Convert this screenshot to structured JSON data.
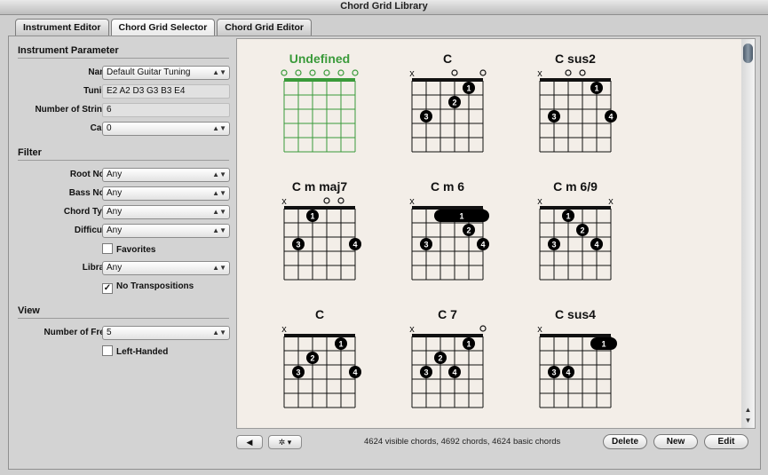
{
  "window": {
    "title": "Chord Grid Library"
  },
  "tabs": [
    {
      "label": "Instrument Editor"
    },
    {
      "label": "Chord Grid Selector"
    },
    {
      "label": "Chord Grid Editor"
    }
  ],
  "instrument": {
    "heading": "Instrument Parameter",
    "name_label": "Name:",
    "name_value": "Default Guitar Tuning",
    "tuning_label": "Tuning:",
    "tuning_value": "E2 A2 D3 G3 B3 E4",
    "strings_label": "Number of Strings:",
    "strings_value": "6",
    "capo_label": "Capo:",
    "capo_value": "0"
  },
  "filter": {
    "heading": "Filter",
    "root_label": "Root Note:",
    "root_value": "Any",
    "bass_label": "Bass Note:",
    "bass_value": "Any",
    "type_label": "Chord Type:",
    "type_value": "Any",
    "difficulty_label": "Difficulty:",
    "difficulty_value": "Any",
    "favorites_label": "Favorites",
    "library_label": "Library:",
    "library_value": "Any",
    "no_transpositions_label": "No Transpositions"
  },
  "view": {
    "heading": "View",
    "frets_label": "Number of Frets:",
    "frets_value": "5",
    "left_handed_label": "Left-Handed"
  },
  "chords": [
    {
      "name": "Undefined",
      "color": "#3a9a3a",
      "top": [
        "o",
        "o",
        "o",
        "o",
        "o",
        "o"
      ],
      "fingers": [],
      "barres": []
    },
    {
      "name": "C",
      "color": "#111111",
      "top": [
        "x",
        "",
        "",
        "o",
        "",
        "o"
      ],
      "fingers": [
        [
          5,
          1,
          "1"
        ],
        [
          4,
          2,
          "2"
        ],
        [
          2,
          3,
          "3"
        ]
      ],
      "barres": []
    },
    {
      "name": "C sus2",
      "color": "#111111",
      "top": [
        "x",
        "",
        "o",
        "o",
        "",
        ""
      ],
      "fingers": [
        [
          5,
          1,
          "1"
        ],
        [
          2,
          3,
          "3"
        ],
        [
          6,
          3,
          "4"
        ]
      ],
      "barres": []
    },
    {
      "name": "C m maj7",
      "color": "#111111",
      "top": [
        "x",
        "",
        "",
        "o",
        "o",
        ""
      ],
      "fingers": [
        [
          3,
          1,
          "1"
        ],
        [
          2,
          3,
          "3"
        ],
        [
          6,
          3,
          "4"
        ]
      ],
      "barres": []
    },
    {
      "name": "C m 6",
      "color": "#111111",
      "top": [
        "x",
        "",
        "",
        "",
        "",
        ""
      ],
      "fingers": [
        [
          5,
          2,
          "2"
        ],
        [
          2,
          3,
          "3"
        ],
        [
          6,
          3,
          "4"
        ]
      ],
      "barres": [
        [
          3,
          6,
          1,
          "1"
        ]
      ]
    },
    {
      "name": "C m 6/9",
      "color": "#111111",
      "top": [
        "x",
        "",
        "",
        "",
        "",
        "x"
      ],
      "fingers": [
        [
          3,
          1,
          "1"
        ],
        [
          4,
          2,
          "2"
        ],
        [
          2,
          3,
          "3"
        ],
        [
          5,
          3,
          "4"
        ]
      ],
      "barres": []
    },
    {
      "name": "C",
      "color": "#111111",
      "top": [
        "x",
        "",
        "",
        "",
        "",
        ""
      ],
      "fingers": [
        [
          5,
          1,
          "1"
        ],
        [
          3,
          2,
          "2"
        ],
        [
          2,
          3,
          "3"
        ],
        [
          6,
          3,
          "4"
        ]
      ],
      "barres": []
    },
    {
      "name": "C 7",
      "color": "#111111",
      "top": [
        "x",
        "",
        "",
        "",
        "",
        "o"
      ],
      "fingers": [
        [
          5,
          1,
          "1"
        ],
        [
          3,
          2,
          "2"
        ],
        [
          2,
          3,
          "3"
        ],
        [
          4,
          3,
          "4"
        ]
      ],
      "barres": []
    },
    {
      "name": "C sus4",
      "color": "#111111",
      "top": [
        "x",
        "",
        "",
        "",
        "",
        ""
      ],
      "fingers": [
        [
          2,
          3,
          "3"
        ],
        [
          3,
          3,
          "4"
        ]
      ],
      "barres": [
        [
          5,
          6,
          1,
          "1"
        ]
      ]
    }
  ],
  "bottom": {
    "speaker_icon": "speaker-icon",
    "gear_icon": "gear-icon",
    "status": "4624 visible chords, 4692 chords, 4624 basic chords",
    "delete_label": "Delete",
    "new_label": "New",
    "edit_label": "Edit"
  }
}
